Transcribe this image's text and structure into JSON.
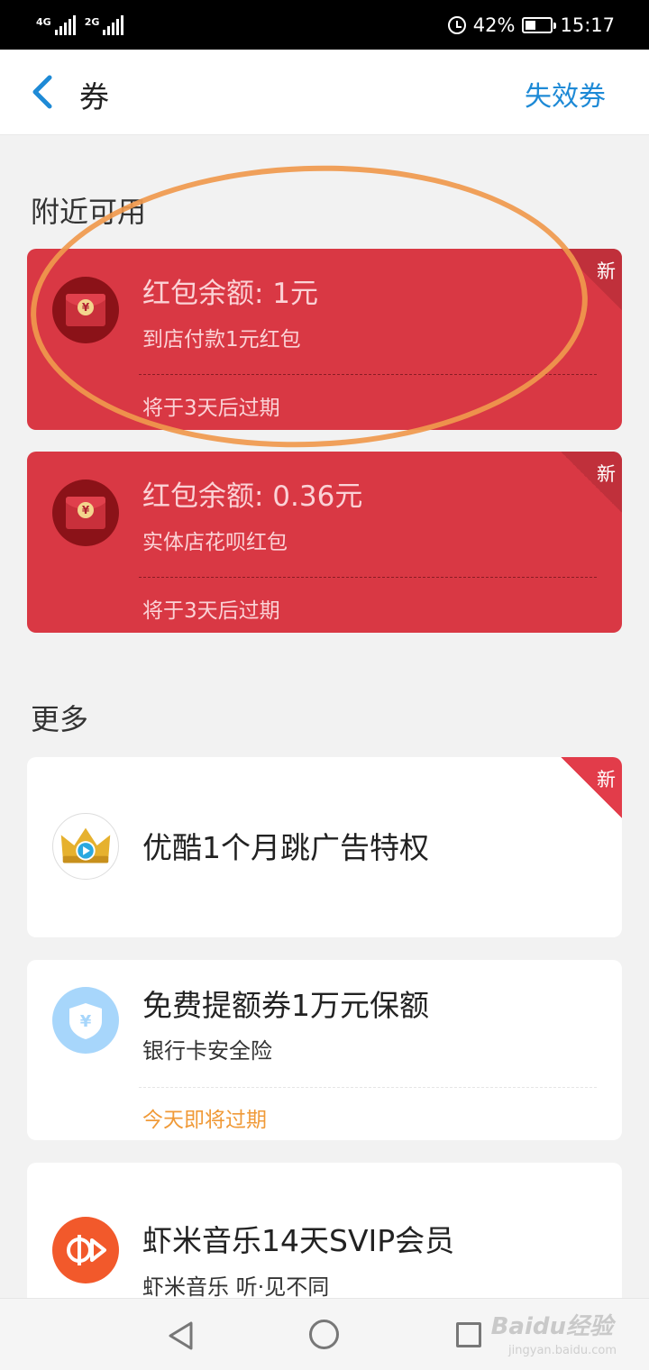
{
  "status_bar": {
    "net1": "4G",
    "net2": "2G",
    "battery": "42%",
    "time": "15:17"
  },
  "header": {
    "title": "券",
    "right_link": "失效券"
  },
  "nearby": {
    "title": "附近可用",
    "coupons": [
      {
        "title": "红包余额: 1元",
        "subtitle": "到店付款1元红包",
        "footer": "将于3天后过期",
        "badge": "新"
      },
      {
        "title": "红包余额: 0.36元",
        "subtitle": "实体店花呗红包",
        "footer": "将于3天后过期",
        "badge": "新"
      }
    ]
  },
  "more": {
    "title": "更多",
    "items": [
      {
        "title": "优酷1个月跳广告特权",
        "badge": "新"
      },
      {
        "title": "免费提额券1万元保额",
        "subtitle": "银行卡安全险",
        "footer": "今天即将过期"
      },
      {
        "title": "虾米音乐14天SVIP会员",
        "subtitle": "虾米音乐 听·见不同"
      }
    ]
  },
  "watermark": {
    "brand": "Baidu经验",
    "url": "jingyan.baidu.com"
  },
  "colors": {
    "accent_blue": "#1e8ad6",
    "coupon_red": "#d93844",
    "expire_orange": "#f09a38",
    "highlight_orange": "#f0994d"
  }
}
